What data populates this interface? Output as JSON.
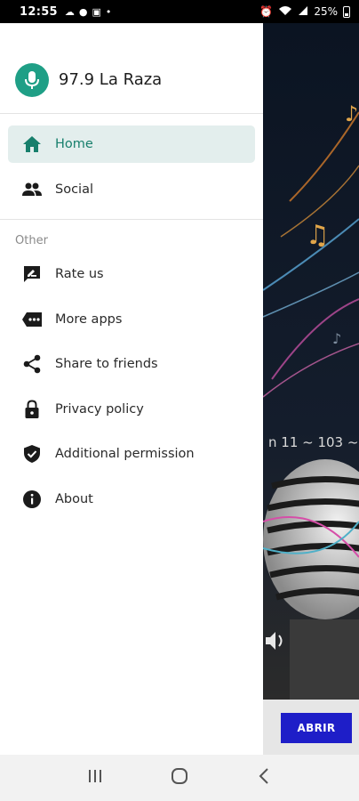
{
  "status_bar": {
    "time": "12:55",
    "battery": "25%",
    "notification_icons": [
      "cloud-icon",
      "chat-icon",
      "bag-icon",
      "dot-icon"
    ],
    "system_icons": [
      "alarm-icon",
      "wifi-icon",
      "signal-icon",
      "battery-icon"
    ]
  },
  "drawer": {
    "app_title": "97.9 La Raza",
    "main_items": [
      {
        "label": "Home",
        "icon": "home-icon",
        "active": true
      },
      {
        "label": "Social",
        "icon": "people-icon",
        "active": false
      }
    ],
    "other_heading": "Other",
    "other_items": [
      {
        "label": "Rate us",
        "icon": "rate-icon"
      },
      {
        "label": "More apps",
        "icon": "more-apps-icon"
      },
      {
        "label": "Share to friends",
        "icon": "share-icon"
      },
      {
        "label": "Privacy policy",
        "icon": "lock-icon"
      },
      {
        "label": "Additional permission",
        "icon": "shield-check-icon"
      },
      {
        "label": "About",
        "icon": "info-icon"
      }
    ]
  },
  "background_app": {
    "partial_text": "n 11 ~ 103 ~",
    "open_button": "ABRIR"
  },
  "colors": {
    "accent": "#1f9f86",
    "active_bg": "#e3eeed",
    "open_button": "#1e1ec8"
  },
  "nav_bar": {
    "buttons": [
      "recents-icon",
      "home-circle-icon",
      "back-icon"
    ]
  }
}
